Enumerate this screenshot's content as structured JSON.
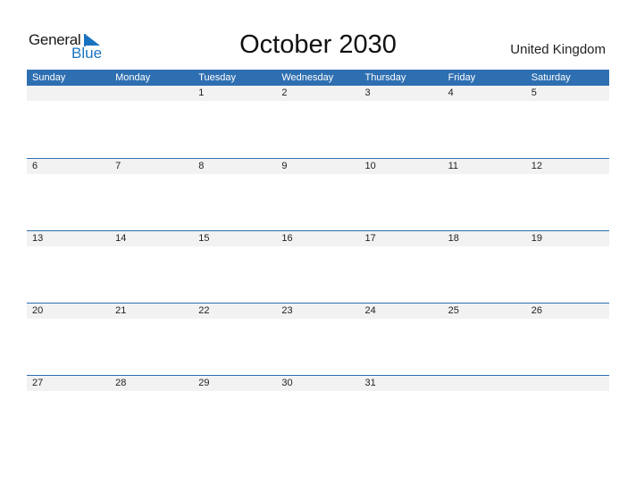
{
  "logo": {
    "line1": "General",
    "line2": "Blue"
  },
  "title": "October 2030",
  "country": "United Kingdom",
  "weekdays": [
    "Sunday",
    "Monday",
    "Tuesday",
    "Wednesday",
    "Thursday",
    "Friday",
    "Saturday"
  ],
  "weeks": [
    [
      "",
      "",
      "1",
      "2",
      "3",
      "4",
      "5"
    ],
    [
      "6",
      "7",
      "8",
      "9",
      "10",
      "11",
      "12"
    ],
    [
      "13",
      "14",
      "15",
      "16",
      "17",
      "18",
      "19"
    ],
    [
      "20",
      "21",
      "22",
      "23",
      "24",
      "25",
      "26"
    ],
    [
      "27",
      "28",
      "29",
      "30",
      "31",
      "",
      ""
    ]
  ],
  "colors": {
    "accent": "#2e6fb1",
    "logo_blue": "#1a73c0",
    "row_bg": "#f2f2f2"
  }
}
